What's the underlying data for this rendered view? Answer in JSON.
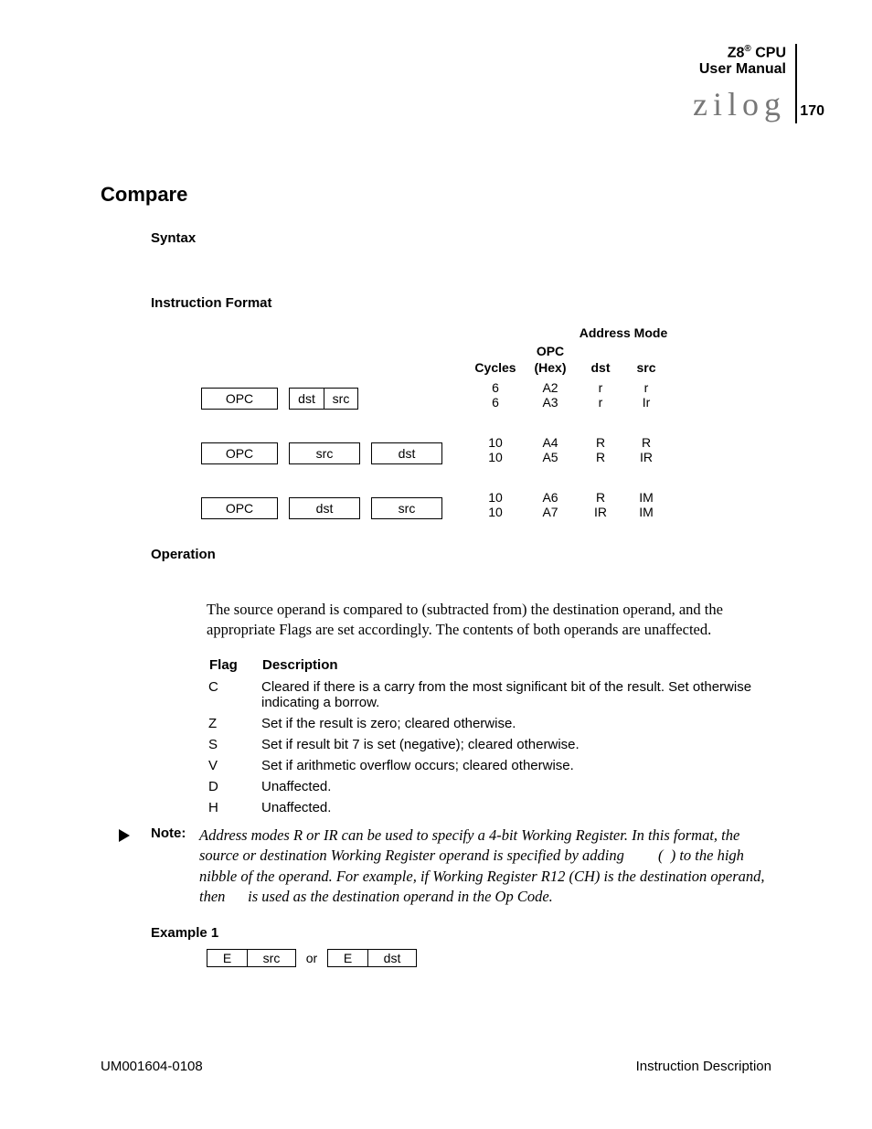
{
  "header": {
    "product": "Z8",
    "reg": "®",
    "cpu": "CPU",
    "manual": "User Manual",
    "logo": "zilog",
    "page": "170"
  },
  "title": "Compare",
  "sections": {
    "syntax": "Syntax",
    "instruction_format": "Instruction Format",
    "operation": "Operation",
    "example1": "Example 1"
  },
  "table_head": {
    "cycles": "Cycles",
    "opc_hex_line1": "OPC",
    "opc_hex_line2": "(Hex)",
    "addr_mode": "Address Mode",
    "dst": "dst",
    "src": "src"
  },
  "box_labels": {
    "opc": "OPC",
    "dst": "dst",
    "src": "src",
    "e": "E",
    "or": "or"
  },
  "rows": [
    {
      "boxes": [
        "opc",
        "halfdstsrc"
      ],
      "data": [
        {
          "cyc": "6",
          "opc": "A2",
          "dst": "r",
          "src": "r"
        },
        {
          "cyc": "6",
          "opc": "A3",
          "dst": "r",
          "src": "Ir"
        }
      ]
    },
    {
      "boxes": [
        "opc",
        "src",
        "dst"
      ],
      "data": [
        {
          "cyc": "10",
          "opc": "A4",
          "dst": "R",
          "src": "R"
        },
        {
          "cyc": "10",
          "opc": "A5",
          "dst": "R",
          "src": "IR"
        }
      ]
    },
    {
      "boxes": [
        "opc",
        "dst",
        "src"
      ],
      "data": [
        {
          "cyc": "10",
          "opc": "A6",
          "dst": "R",
          "src": "IM"
        },
        {
          "cyc": "10",
          "opc": "A7",
          "dst": "IR",
          "src": "IM"
        }
      ]
    }
  ],
  "operation_text": "The source operand is compared to (subtracted from) the destination operand, and the appropriate Flags are set accordingly. The contents of both operands are unaffected.",
  "flag_head": {
    "flag": "Flag",
    "desc": "Description"
  },
  "flags": [
    {
      "f": "C",
      "d": "Cleared if there is a carry from the most significant bit of the result. Set otherwise indicating a borrow."
    },
    {
      "f": "Z",
      "d": "Set if the result is zero; cleared otherwise."
    },
    {
      "f": "S",
      "d": "Set if result bit 7 is set (negative); cleared otherwise."
    },
    {
      "f": "V",
      "d": "Set if arithmetic overflow occurs; cleared otherwise."
    },
    {
      "f": "D",
      "d": "Unaffected."
    },
    {
      "f": "H",
      "d": "Unaffected."
    }
  ],
  "note": {
    "label": "Note:",
    "body": "Address modes R or IR can be used to specify a 4-bit Working Register. In this format, the source or destination Working Register operand is specified by adding         (  ) to the high nibble of the operand. For example, if Working Register R12 (CH) is the destination operand, then      is used as the destination operand in the Op Code."
  },
  "footer": {
    "left": "UM001604-0108",
    "right": "Instruction Description"
  }
}
